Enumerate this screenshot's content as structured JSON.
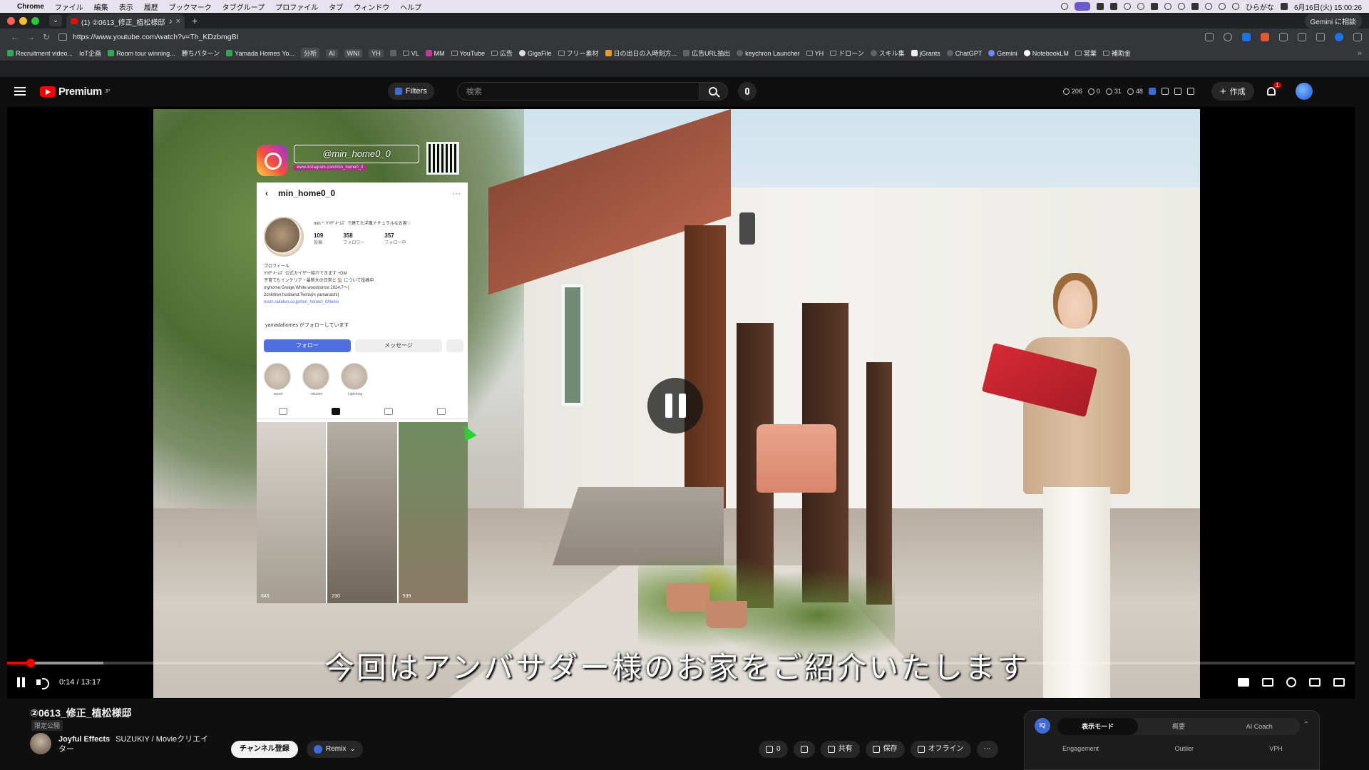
{
  "menubar": {
    "app": "Chrome",
    "items": [
      "ファイル",
      "編集",
      "表示",
      "履歴",
      "ブックマーク",
      "タブグループ",
      "プロファイル",
      "タブ",
      "ウィンドウ",
      "ヘルプ"
    ],
    "ime": "ひらがな",
    "clock": "6月16日(火) 15:00:26"
  },
  "browser": {
    "tab_title": "(1) ②0613_修正_植松様邸",
    "url": "https://www.youtube.com/watch?v=Th_KDzbmgBI",
    "gemini_button": "Gemini に相談",
    "bookmarks": [
      "Recruitment video...",
      "IoT企画",
      "Room tour winning...",
      "勝ちパターン",
      "Yamada Homes Yo...",
      "分析",
      "AI",
      "WNI",
      "YH",
      "VL",
      "MM",
      "YouTube",
      "広告",
      "GigaFile",
      "フリー素材",
      "日の出日の入時刻方...",
      "広告URL抽出",
      "keychron Launcher",
      "YH",
      "ドローン",
      "スキル集",
      "jGrants",
      "ChatGPT",
      "Gemini",
      "NotebookLM",
      "営業",
      "補助金"
    ]
  },
  "youtube": {
    "logo_text": "Premium",
    "logo_sup": "JP",
    "filters_label": "Filters",
    "search_placeholder": "検索",
    "stats": [
      "206",
      "0",
      "31",
      "48"
    ],
    "create_label": "作成",
    "notif_count": "1"
  },
  "video": {
    "ig": {
      "handle": "@min_home0_0",
      "url_small": "www.instagram.com/min_home0_0",
      "username": "min_home0_0",
      "bio_head": "min *: YYF ﾎｰﾑｽﾞ で建てた洋風ナチュラルなお家♡",
      "posts": "109",
      "posts_label": "投稿",
      "followers": "358",
      "followers_label": "フォロワー",
      "following": "357",
      "following_label": "フォロー中",
      "bio_lines": [
        "プロフィール",
        "YYF ﾎｰﾑｽﾞ 公式カイザー紹介できます +DM",
        "子育てもインテリア・最新大の日常と 🏠 について投稿中",
        "myhome:Greige,White,wood(since 2024.7〜)",
        "2children:husband:Twins(in yamanashi)"
      ],
      "bio_link": "room.rakuten.co.jp/min_home0_0/items",
      "followed_by": "yamadahomes がフォローしています",
      "follow_btn": "フォロー",
      "message_btn": "メッセージ",
      "highlights": [
        "report",
        "rakuten",
        "Lightning"
      ],
      "grid_counts": [
        "843",
        "230",
        "539"
      ]
    },
    "subtitle": "今回はアンバサダー様のお家をご紹介いたします",
    "time_current": "0:14",
    "time_total": "13:17",
    "progress_fraction": 0.0176
  },
  "below": {
    "title": "②0613_修正_植松様邸",
    "visibility": "限定公開",
    "channel": "Joyful Effects",
    "channel_sub": "SUZUKIY / Movieクリエイター",
    "subscribe": "チャンネル登録",
    "remix": "Remix",
    "likes": "0",
    "share": "共有",
    "save": "保存",
    "offline": "オフライン",
    "more": "⋯"
  },
  "iq_panel": {
    "logo": "IQ",
    "tabs": [
      "表示モード",
      "概要",
      "AI Coach"
    ],
    "metrics": [
      "Engagement",
      "Outlier",
      "VPH"
    ]
  },
  "colors": {
    "accent": "#ff0000",
    "iq_blue": "#3f6bd8",
    "page_bg": "#0f0f0f"
  }
}
